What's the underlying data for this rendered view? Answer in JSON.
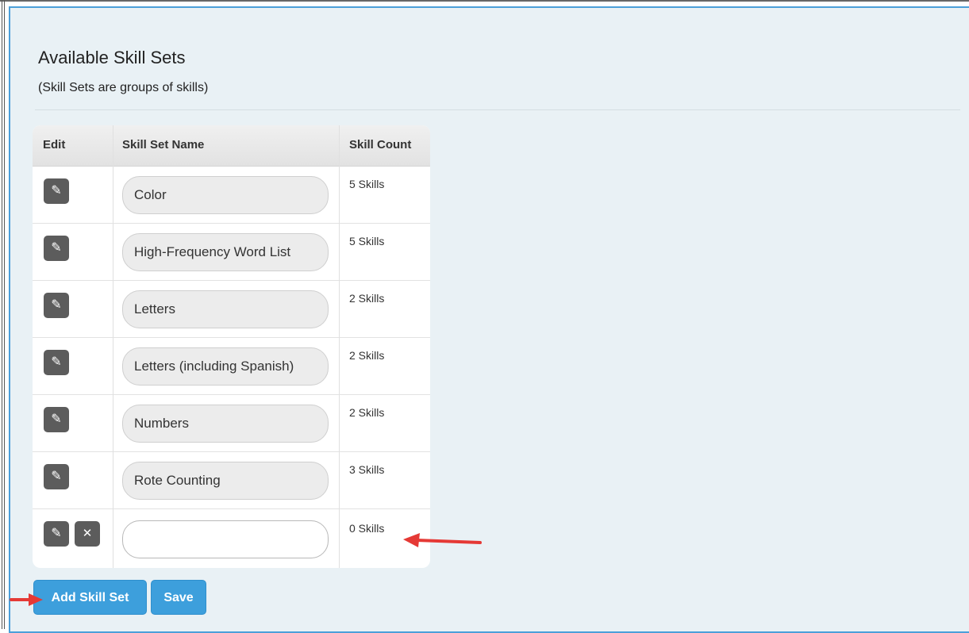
{
  "section": {
    "title": "Available Skill Sets",
    "subtitle": "(Skill Sets are groups of skills)"
  },
  "table": {
    "headers": [
      "Edit",
      "Skill Set Name",
      "Skill Count"
    ],
    "rows": [
      {
        "name": "Color",
        "count": "5 Skills"
      },
      {
        "name": "High-Frequency Word List",
        "count": "5 Skills"
      },
      {
        "name": "Letters",
        "count": "2 Skills"
      },
      {
        "name": "Letters (including Spanish)",
        "count": "2 Skills"
      },
      {
        "name": "Numbers",
        "count": "2 Skills"
      },
      {
        "name": "Rote Counting",
        "count": "3 Skills"
      },
      {
        "name": "",
        "count": "0 Skills"
      }
    ]
  },
  "buttons": {
    "add_label": "Add Skill Set",
    "save_label": "Save"
  },
  "icons": {
    "edit": "pencil-icon",
    "delete": "close-icon"
  },
  "colors": {
    "accent": "#3d9fdc",
    "panel_border": "#4b9fd9",
    "panel_bg": "#e9f1f5",
    "annotation_arrow": "#e53935"
  }
}
